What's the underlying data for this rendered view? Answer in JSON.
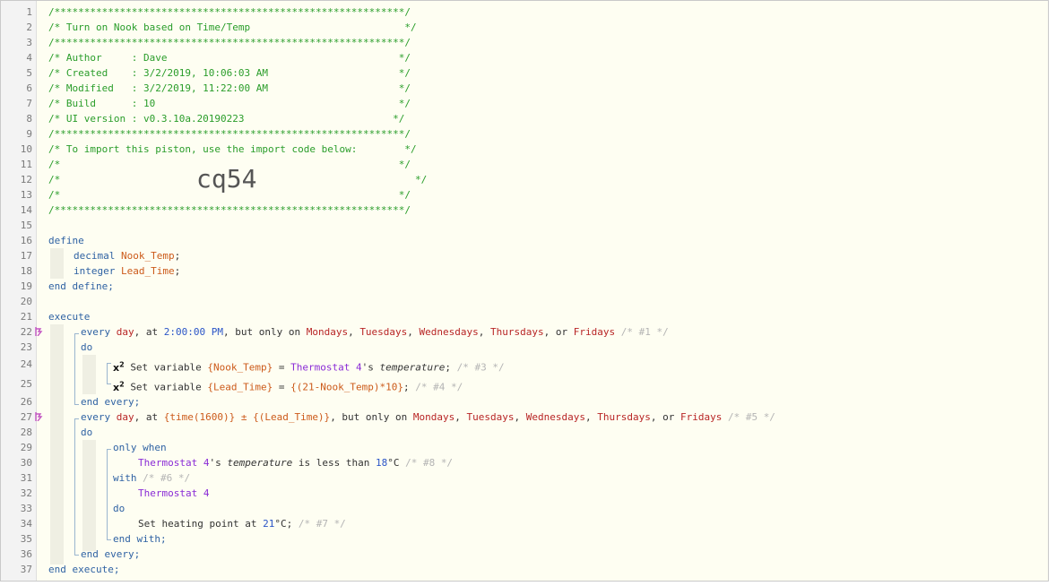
{
  "header": {
    "border": "/***********************************************************/",
    "title": "/* Turn on Nook based on Time/Temp                          */",
    "author": "/* Author     : Dave                                       */",
    "created": "/* Created    : 3/2/2019, 10:06:03 AM                      */",
    "modified": "/* Modified   : 3/2/2019, 11:22:00 AM                      */",
    "build": "/* Build      : 10                                         */",
    "ui_version": "/* UI version : v0.3.10a.20190223                         */",
    "import_text": "/* To import this piston, use the import code below:        */",
    "blank": "/*                                                         */",
    "blank_prefix": "/*",
    "import_code": "cq54",
    "blank_suffix": "*/"
  },
  "lines": [
    "1",
    "2",
    "3",
    "4",
    "5",
    "6",
    "7",
    "8",
    "9",
    "10",
    "11",
    "12",
    "13",
    "14",
    "15",
    "16",
    "17",
    "18",
    "19",
    "20",
    "21",
    "22",
    "23",
    "24",
    "25",
    "26",
    "27",
    "28",
    "29",
    "30",
    "31",
    "32",
    "33",
    "34",
    "35",
    "36",
    "37"
  ],
  "code": {
    "define": "define",
    "end_define": "end define;",
    "decimal": "decimal",
    "integer": "integer",
    "var1": "Nook_Temp",
    "var2": "Lead_Time",
    "semi": ";",
    "execute": "execute",
    "end_execute": "end execute;",
    "every": "every",
    "day": "day",
    "at": ", at",
    "time1": "2:00:00 PM",
    "but_only_on": ", but only on",
    "mondays": "Mondays",
    "tuesdays": "Tuesdays",
    "wednesdays": "Wednesdays",
    "thursdays": "Thursdays",
    "or": ", or",
    "fridays": "Fridays",
    "comma": ",",
    "c1": "/* #1 */",
    "do": "do",
    "x": "x",
    "sup": "2",
    "set_variable": "Set variable",
    "nook_var": "{Nook_Temp}",
    "eq": "=",
    "thermostat4": "Thermostat 4",
    "s_apostrophe": "'s",
    "temperature": "temperature",
    "c3": "/* #3 */",
    "lead_var": "{Lead_Time}",
    "lead_expr": "{(21-Nook_Temp)*10}",
    "c4": "/* #4 */",
    "end_every": "end every;",
    "time_expr": "{time(1600)} ± {(Lead_Time)}",
    "c5": "/* #5 */",
    "only_when": "only when",
    "is_less_than": "is less than",
    "temp18": "18",
    "deg": "°C",
    "c8": "/* #8 */",
    "with": "with",
    "c6": "/* #6 */",
    "set_heating": "Set heating point at",
    "temp21": "21",
    "c7": "/* #7 */",
    "end_with": "end with;"
  },
  "colors": {
    "marker": "#c254c2",
    "comment": "#2a9d2a",
    "keyword": "#2f62a3"
  }
}
